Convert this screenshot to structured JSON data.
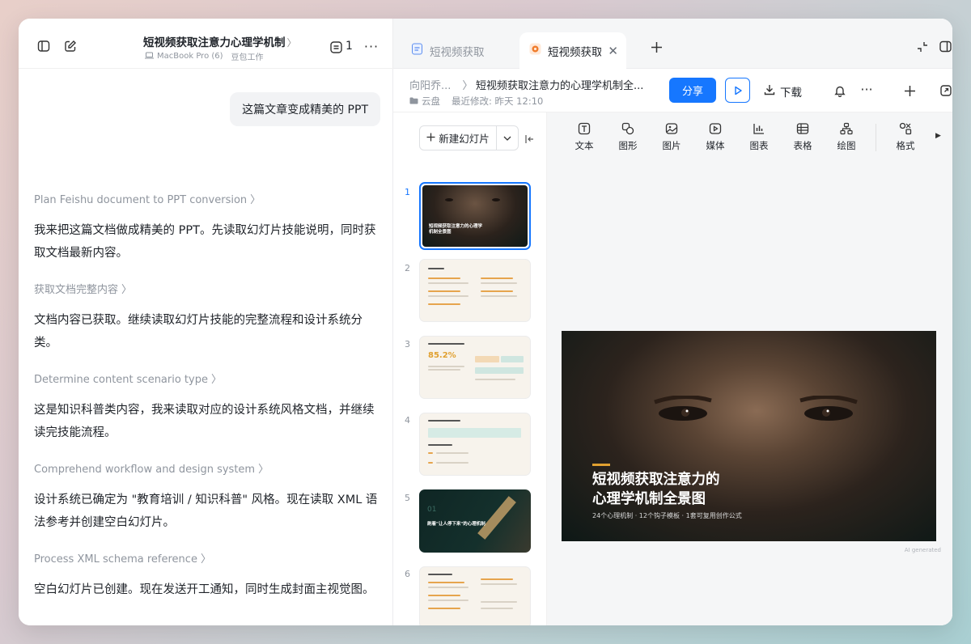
{
  "left": {
    "title": "短视频获取注意力心理学机制",
    "device": "MacBook Pro (6)",
    "workspace": "豆包工作",
    "task_count": "1"
  },
  "chat": {
    "user_message": "这篇文章变成精美的 PPT",
    "entries": [
      {
        "step": "Plan Feishu document to PPT conversion",
        "message": "我来把这篇文档做成精美的 PPT。先读取幻灯片技能说明，同时获取文档最新内容。"
      },
      {
        "step": "获取文档完整内容",
        "message": "文档内容已获取。继续读取幻灯片技能的完整流程和设计系统分类。"
      },
      {
        "step": "Determine content scenario type",
        "message": "这是知识科普类内容，我来读取对应的设计系统风格文档，并继续读完技能流程。"
      },
      {
        "step": "Comprehend workflow and design system",
        "message": "设计系统已确定为 \"教育培训 / 知识科普\" 风格。现在读取 XML 语法参考并创建空白幻灯片。"
      },
      {
        "step": "Process XML schema reference",
        "message": "空白幻灯片已创建。现在发送开工通知，同时生成封面主视觉图。"
      }
    ]
  },
  "tabs": [
    {
      "label": "短视频获取",
      "active": false
    },
    {
      "label": "短视频获取注",
      "active": true
    }
  ],
  "doc": {
    "owner": "向阳乔...",
    "title": "短视频获取注意力的心理学机制全...",
    "location": "云盘",
    "modified": "最近修改: 昨天 12:10",
    "share": "分享",
    "download": "下载"
  },
  "slides_panel": {
    "new_slide": "新建幻灯片",
    "numbers": [
      "1",
      "2",
      "3",
      "4",
      "5",
      "6"
    ],
    "thumb3_stat": "85.2%",
    "thumb5_label": "刷着\"让人停下来\"的心理机制",
    "thumb1_title": "短视频获取注意力的心理学机制全景图"
  },
  "toolbar": {
    "items": [
      "文本",
      "图形",
      "图片",
      "媒体",
      "图表",
      "表格",
      "绘图",
      "格式"
    ]
  },
  "slide": {
    "title_line1": "短视频获取注意力的",
    "title_line2": "心理学机制全景图",
    "subtitle": "24个心理机制 · 12个钩子模板 · 1套可复用创作公式",
    "ai_label": "AI generated"
  },
  "colors": {
    "accent": "#1677ff",
    "gold": "#e0a030"
  }
}
